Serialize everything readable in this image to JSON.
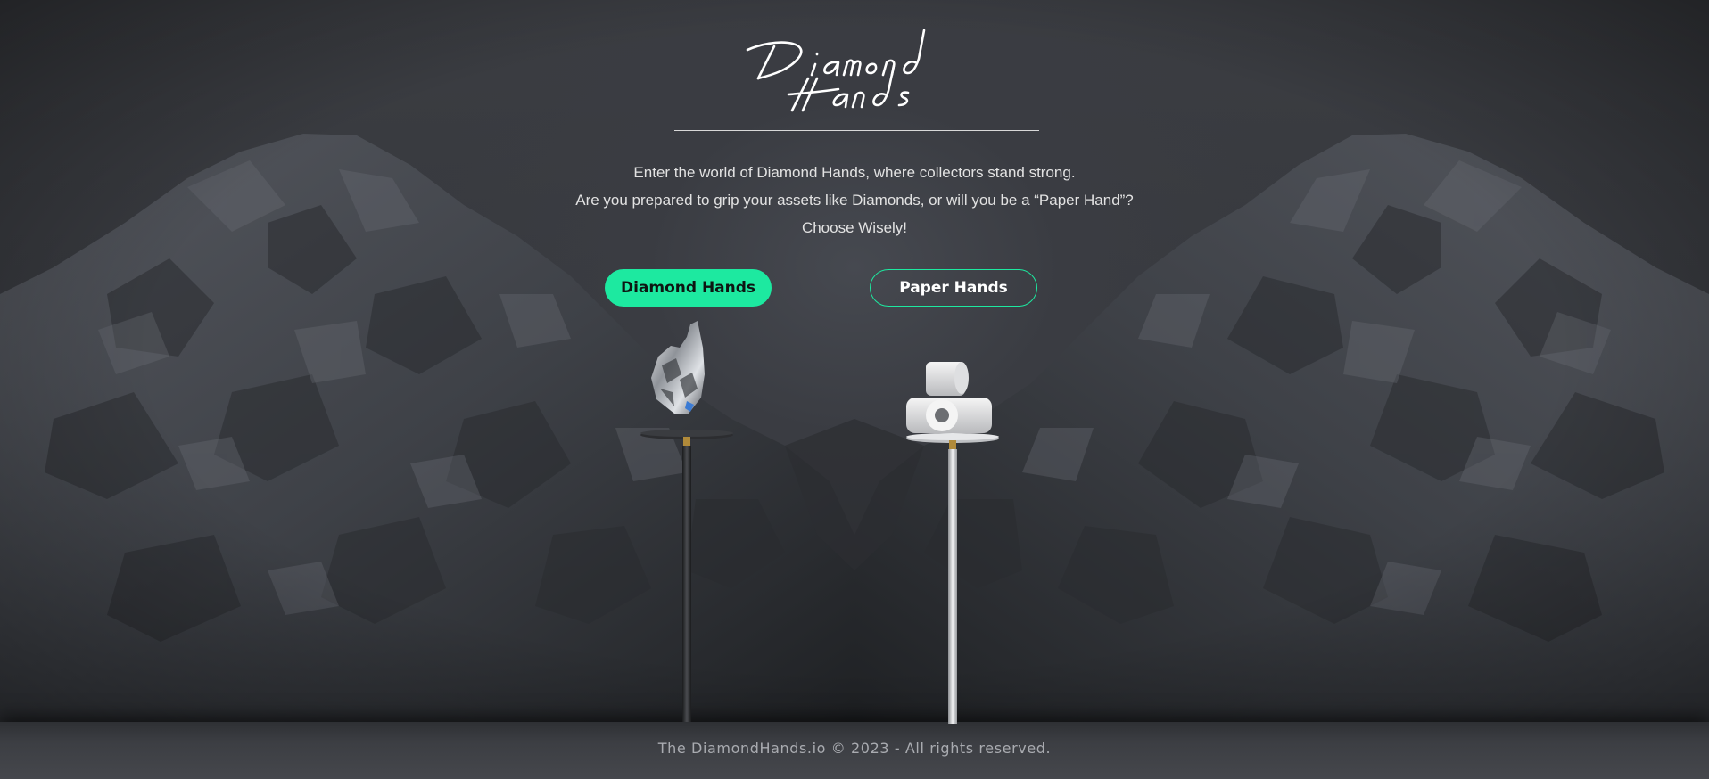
{
  "brand": {
    "logo_line1": "Diamond",
    "logo_line2": "Hands"
  },
  "intro": {
    "line1": "Enter the world of Diamond Hands, where collectors stand strong.",
    "line2": "Are you prepared to grip your assets like Diamonds, or will you be a “Paper Hand”?",
    "line3": "Choose Wisely!"
  },
  "choices": {
    "diamond_label": "Diamond Hands",
    "paper_label": "Paper Hands"
  },
  "footer": {
    "copyright": "The DiamondHands.io © 2023 - All rights reserved."
  },
  "colors": {
    "accent": "#1de9a0",
    "background": "#34363b",
    "text": "#e2e2e2"
  },
  "icons": {
    "diamond_trophy": "diamond-hand-trophy-icon",
    "paper_trophy": "toilet-paper-trophy-icon"
  }
}
